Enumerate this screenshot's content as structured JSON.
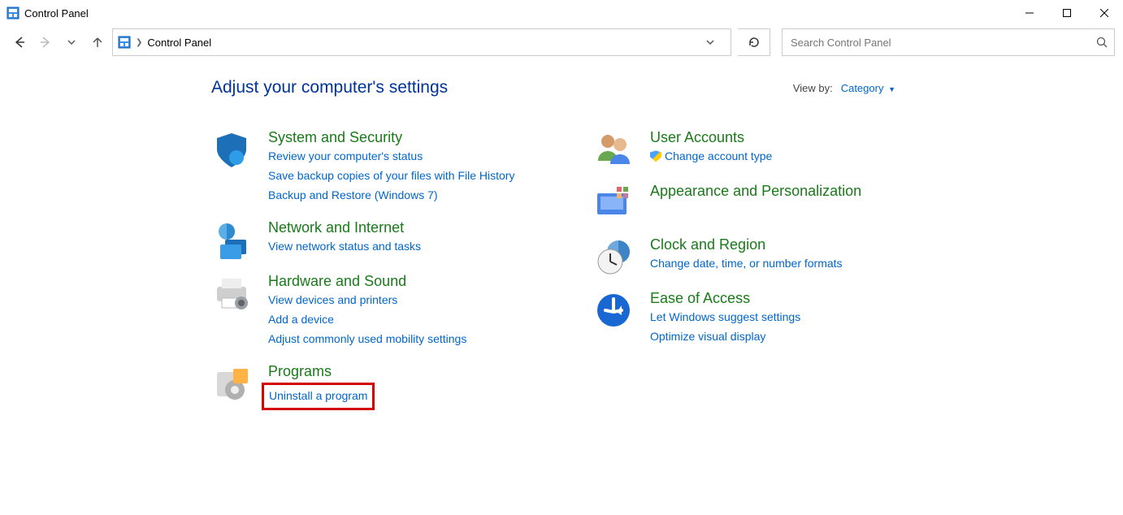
{
  "window": {
    "title": "Control Panel"
  },
  "addressbar": {
    "location": "Control Panel"
  },
  "search": {
    "placeholder": "Search Control Panel"
  },
  "header": {
    "heading": "Adjust your computer's settings",
    "viewby_label": "View by:",
    "viewby_value": "Category"
  },
  "categories": {
    "left": [
      {
        "icon": "shield-icon",
        "title": "System and Security",
        "links": [
          "Review your computer's status",
          "Save backup copies of your files with File History",
          "Backup and Restore (Windows 7)"
        ]
      },
      {
        "icon": "network-icon",
        "title": "Network and Internet",
        "links": [
          "View network status and tasks"
        ]
      },
      {
        "icon": "printer-icon",
        "title": "Hardware and Sound",
        "links": [
          "View devices and printers",
          "Add a device",
          "Adjust commonly used mobility settings"
        ]
      },
      {
        "icon": "programs-icon",
        "title": "Programs",
        "links": [
          "Uninstall a program"
        ]
      }
    ],
    "right": [
      {
        "icon": "users-icon",
        "title": "User Accounts",
        "links_shield": [
          "Change account type"
        ]
      },
      {
        "icon": "appearance-icon",
        "title": "Appearance and Personalization",
        "links": []
      },
      {
        "icon": "clock-icon",
        "title": "Clock and Region",
        "links": [
          "Change date, time, or number formats"
        ]
      },
      {
        "icon": "ease-icon",
        "title": "Ease of Access",
        "links": [
          "Let Windows suggest settings",
          "Optimize visual display"
        ]
      }
    ]
  }
}
